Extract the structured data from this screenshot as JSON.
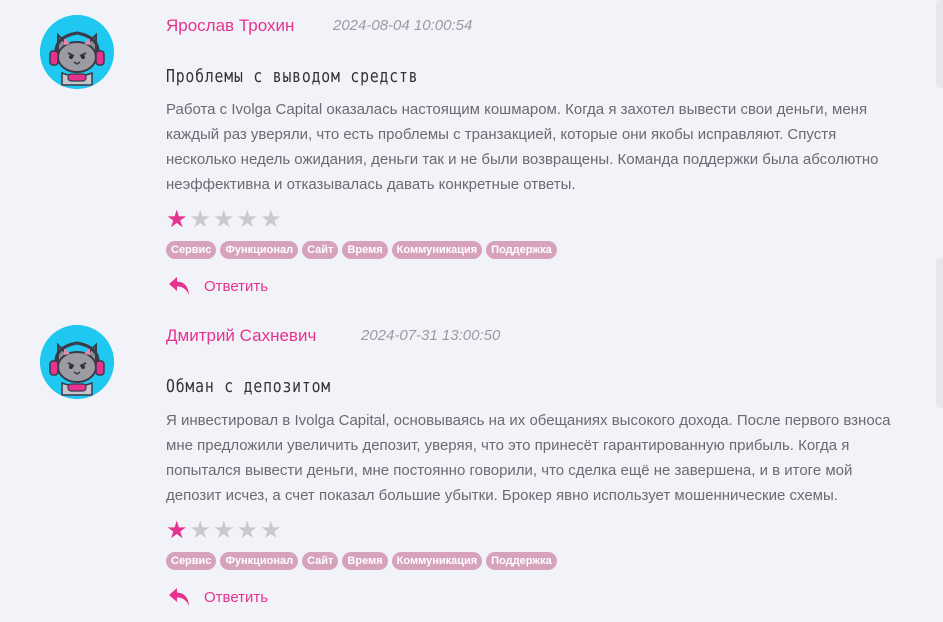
{
  "reviews": [
    {
      "author": "Ярослав Трохин",
      "date": "2024-08-04 10:00:54",
      "title": "Проблемы с выводом средств",
      "text": "Работа с Ivolga Capital оказалась настоящим кошмаром. Когда я захотел вывести свои деньги, меня каждый раз уверяли, что есть проблемы с транзакцией, которые они якобы исправляют. Спустя несколько недель ожидания, деньги так и не были возвращены. Команда поддержки была абсолютно неэффективна и отказывалась давать конкретные ответы.",
      "rating": 1,
      "rating_max": 5,
      "tags": [
        "Сервис",
        "Функционал",
        "Сайт",
        "Время",
        "Коммуникация",
        "Поддержка"
      ],
      "reply_label": "Ответить"
    },
    {
      "author": "Дмитрий Сахневич",
      "date": "2024-07-31 13:00:50",
      "title": "Обман с депозитом",
      "text": "Я инвестировал в Ivolga Capital, основываясь на их обещаниях высокого дохода. После первого взноса мне предложили увеличить депозит, уверяя, что это принесёт гарантированную прибыль. Когда я попытался вывести деньги, мне постоянно говорили, что сделка ещё не завершена, и в итоге мой депозит исчез, а счет показал большие убытки. Брокер явно использует мошеннические схемы.",
      "rating": 1,
      "rating_max": 5,
      "tags": [
        "Сервис",
        "Функционал",
        "Сайт",
        "Время",
        "Коммуникация",
        "Поддержка"
      ],
      "reply_label": "Ответить"
    }
  ],
  "colors": {
    "accent": "#e6338f",
    "tag_bg": "#d6a2bc",
    "avatar_bg": "#1ec8f0",
    "page_bg": "#f2f3f8"
  },
  "icons": {
    "avatar": "gamer-cat-avatar",
    "reply": "reply-arrow-icon",
    "star": "star-icon"
  }
}
